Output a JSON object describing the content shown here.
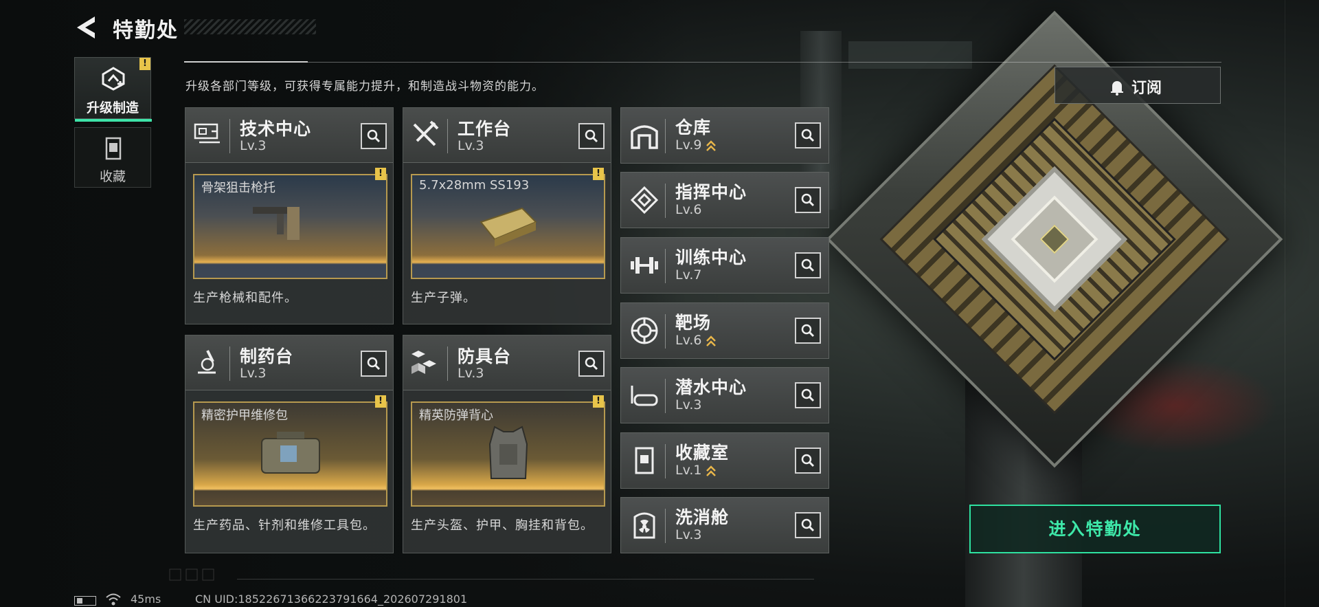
{
  "header": {
    "title": "特勤处",
    "subtitle": "升级各部门等级，可获得专属能力提升，和制造战斗物资的能力。"
  },
  "tabs": [
    {
      "label": "升级制造",
      "active": true,
      "alert": "!"
    },
    {
      "label": "收藏",
      "active": false
    }
  ],
  "cards": [
    {
      "name": "技术中心",
      "level": "Lv.3",
      "preview_label": "骨架狙击枪托",
      "alert": "!",
      "desc": "生产枪械和配件。",
      "icon": "monitor-icon"
    },
    {
      "name": "工作台",
      "level": "Lv.3",
      "preview_label": "5.7x28mm SS193",
      "alert": "!",
      "desc": "生产子弹。",
      "icon": "tools-icon"
    },
    {
      "name": "制药台",
      "level": "Lv.3",
      "preview_label": "精密护甲维修包",
      "alert": "!",
      "desc": "生产药品、针剂和维修工具包。",
      "icon": "microscope-icon"
    },
    {
      "name": "防具台",
      "level": "Lv.3",
      "preview_label": "精英防弹背心",
      "alert": "!",
      "desc": "生产头盔、护甲、胸挂和背包。",
      "icon": "cubes-icon"
    }
  ],
  "facilities": [
    {
      "name": "仓库",
      "level": "Lv.9",
      "upgradable": true,
      "icon": "warehouse-icon"
    },
    {
      "name": "指挥中心",
      "level": "Lv.6",
      "upgradable": false,
      "icon": "chip-icon"
    },
    {
      "name": "训练中心",
      "level": "Lv.7",
      "upgradable": false,
      "icon": "dumbbell-icon"
    },
    {
      "name": "靶场",
      "level": "Lv.6",
      "upgradable": true,
      "icon": "target-icon"
    },
    {
      "name": "潜水中心",
      "level": "Lv.3",
      "upgradable": false,
      "icon": "goggles-icon"
    },
    {
      "name": "收藏室",
      "level": "Lv.1",
      "upgradable": true,
      "icon": "trophy-icon"
    },
    {
      "name": "洗消舱",
      "level": "Lv.3",
      "upgradable": false,
      "icon": "radiation-icon"
    }
  ],
  "buttons": {
    "subscribe": "订阅",
    "enter": "进入特勤处"
  },
  "footer": {
    "ping": "45ms",
    "uid": "CN UID:1852267136622379​1664_202607291801"
  },
  "colors": {
    "accent": "#3ee8a9",
    "alert": "#e8c44a",
    "upgrade_chevron": "#e8b64a"
  }
}
